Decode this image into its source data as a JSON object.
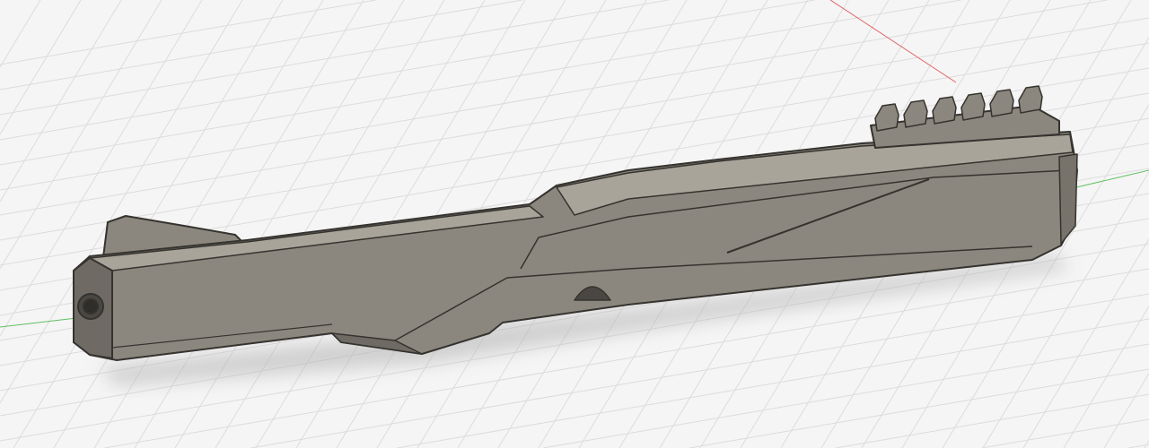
{
  "viewport": {
    "background_color": "#f5f5f5",
    "grid_color": "#dcdcdc",
    "x_axis_color": "#e06060",
    "y_axis_color": "#60c060",
    "model_face_color": "#8c877e",
    "model_top_color": "#a9a499",
    "model_edge_color": "#35332f"
  },
  "icons": [
    "axis-x-icon",
    "axis-y-icon"
  ]
}
